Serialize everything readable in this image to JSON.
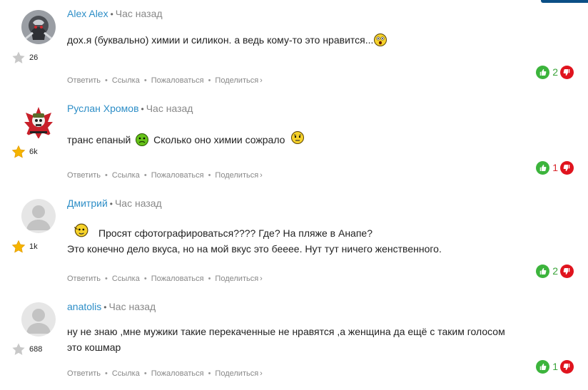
{
  "ui": {
    "accent_color": "#0b4f86",
    "link_color": "#2d8ec7",
    "upvote_color": "#3cb43c",
    "downvote_color": "#e0141e"
  },
  "comments": [
    {
      "author": "Alex Alex",
      "time": "Час назад",
      "rating": "26",
      "rating_star": "grey",
      "lines": [
        "дох.я (буквально) химии и силикон. а ведь кому-то это нравится..."
      ],
      "emojis": [
        "surprised-smiley"
      ],
      "actions": {
        "reply": "Ответить",
        "link": "Ссылка",
        "report": "Пожаловаться",
        "share": "Поделиться"
      },
      "score": "2",
      "score_sign": "positive"
    },
    {
      "author": "Руслан Хромов",
      "time": "Час назад",
      "rating": "6k",
      "rating_star": "gold",
      "lines": [
        "транс епаный",
        "Сколько оно химии сожрало"
      ],
      "emojis": [
        "sick-smiley",
        "wondering-smiley"
      ],
      "actions": {
        "reply": "Ответить",
        "link": "Ссылка",
        "report": "Пожаловаться",
        "share": "Поделиться"
      },
      "score": "1",
      "score_sign": "negative"
    },
    {
      "author": "Дмитрий",
      "time": "Час назад",
      "rating": "1k",
      "rating_star": "gold",
      "lines": [
        "Просят сфотографироваться???? Где? На пляже в Анапе?",
        "Это конечно дело вкуса, но на мой вкус это беeee. Нут тут ничего женственного."
      ],
      "emojis": [
        "pointing-smiley"
      ],
      "actions": {
        "reply": "Ответить",
        "link": "Ссылка",
        "report": "Пожаловаться",
        "share": "Поделиться"
      },
      "score": "2",
      "score_sign": "positive"
    },
    {
      "author": "anatolis",
      "time": "Час назад",
      "rating": "688",
      "rating_star": "grey",
      "lines": [
        "ну не знаю ,мне мужики такие перекаченные не нравятся ,а женщина да ещё с таким голосом",
        "это кошмар"
      ],
      "emojis": [],
      "actions": {
        "reply": "Ответить",
        "link": "Ссылка",
        "report": "Пожаловаться",
        "share": "Поделиться"
      },
      "score": "1",
      "score_sign": "positive"
    }
  ]
}
